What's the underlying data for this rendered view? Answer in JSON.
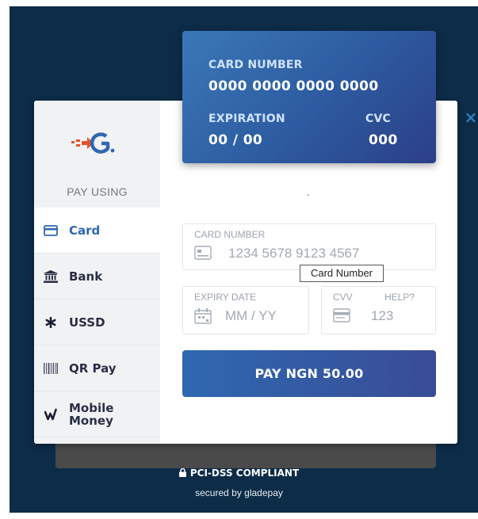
{
  "header": {
    "close_symbol": "×"
  },
  "card_preview": {
    "number_label": "CARD NUMBER",
    "number_value": "0000 0000 0000 0000",
    "expiration_label": "EXPIRATION",
    "expiration_value": "00 / 00",
    "cvc_label": "CVC",
    "cvc_value": "000"
  },
  "sidebar": {
    "heading": "PAY USING",
    "items": [
      {
        "label": "Card",
        "icon": "credit-card-icon",
        "active": true
      },
      {
        "label": "Bank",
        "icon": "bank-icon",
        "active": false
      },
      {
        "label": "USSD",
        "icon": "asterisk-icon",
        "active": false
      },
      {
        "label": "QR Pay",
        "icon": "barcode-icon",
        "active": false
      },
      {
        "label": "Mobile Money",
        "icon": "mobile-money-icon",
        "active": false
      }
    ]
  },
  "form": {
    "card_number_label": "CARD NUMBER",
    "card_number_placeholder": "1234 5678 9123 4567",
    "tooltip": "Card Number",
    "expiry_label": "EXPIRY DATE",
    "expiry_placeholder": "MM / YY",
    "cvv_label": "CVV",
    "cvv_help": "HELP?",
    "cvv_placeholder": "123"
  },
  "pay_button_label": "PAY NGN 50.00",
  "footer": {
    "compliance": "PCI-DSS COMPLIANT",
    "secured_by": "secured by gladepay"
  },
  "colors": {
    "backdrop": "#0d2c48",
    "accent": "#2e67b1",
    "button_gradient_end": "#3a4c97"
  }
}
